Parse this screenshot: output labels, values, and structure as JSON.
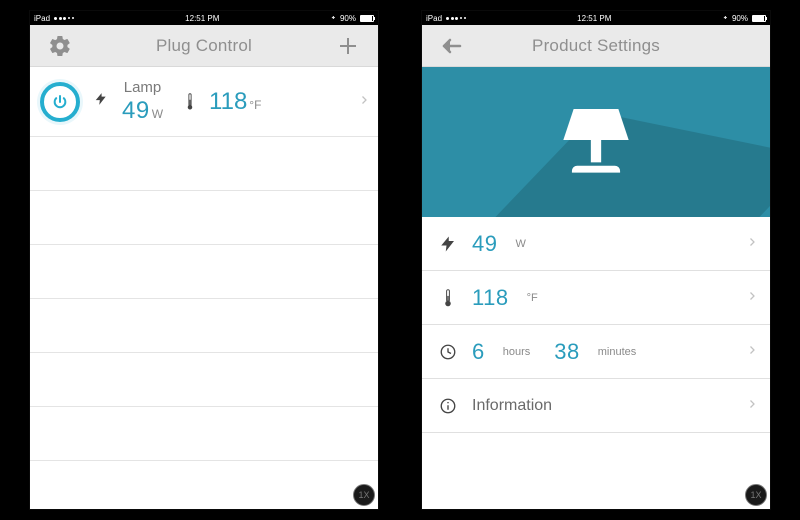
{
  "status": {
    "carrier": "iPad",
    "wifi": "•",
    "time": "12:51 PM",
    "bt": "฿",
    "battery_pct": "90%"
  },
  "left": {
    "title": "Plug Control",
    "device": {
      "name": "Lamp",
      "watts_value": "49",
      "watts_unit": "W",
      "temp_value": "118",
      "temp_unit": "°F"
    }
  },
  "right": {
    "title": "Product Settings",
    "rows": {
      "watts_value": "49",
      "watts_unit": "W",
      "temp_value": "118",
      "temp_unit": "°F",
      "hours_value": "6",
      "hours_unit": "hours",
      "minutes_value": "38",
      "minutes_unit": "minutes",
      "info_label": "Information"
    }
  },
  "badge": "1X"
}
